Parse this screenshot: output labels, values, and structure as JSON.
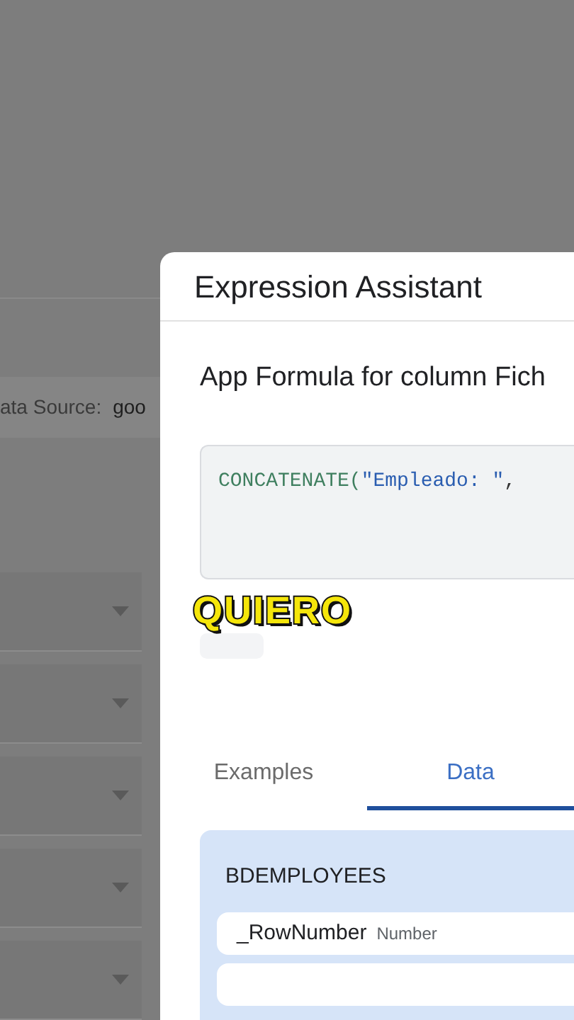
{
  "background": {
    "data_source_label": "ata Source:",
    "data_source_value": "goo"
  },
  "dialog": {
    "title": "Expression Assistant",
    "subtitle": "App Formula for column Fich",
    "expression": [
      {
        "kind": "function",
        "text": "CONCATENATE("
      },
      {
        "kind": "string",
        "text": "\"Empleado: \""
      },
      {
        "kind": "punct",
        "text": ","
      }
    ],
    "tabs": [
      {
        "label": "Examples",
        "selected": false
      },
      {
        "label": "Data",
        "selected": true
      }
    ],
    "table": {
      "name": "BDEMPLOYEES",
      "columns": [
        {
          "name": "_RowNumber",
          "type": "Number"
        }
      ]
    }
  },
  "caption": "QUIERO"
}
